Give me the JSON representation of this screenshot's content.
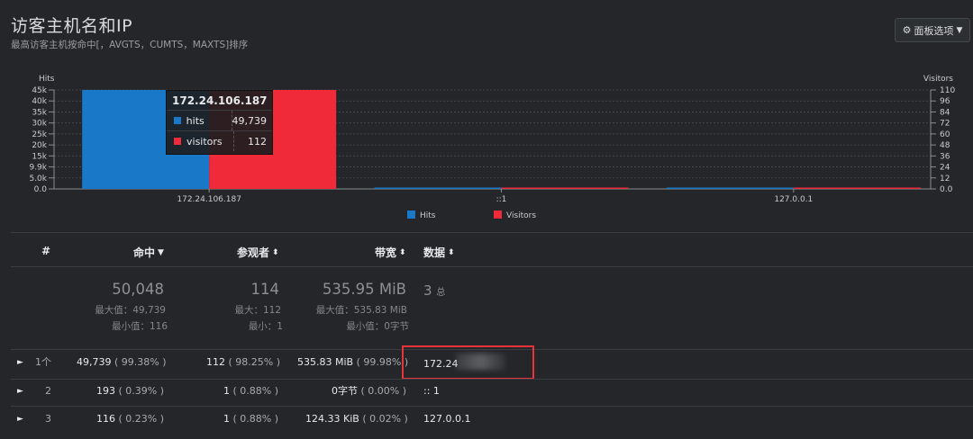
{
  "panel": {
    "title": "访客主机名和IP",
    "subtitle": "最高访客主机按命中[，AVGTS，CUMTS，MAXTS]排序",
    "options_label": "面板选项"
  },
  "chart_data": {
    "type": "bar",
    "categories": [
      "172.24.106.187",
      "::1",
      "127.0.0.1"
    ],
    "series": [
      {
        "name": "Hits",
        "values": [
          49739,
          193,
          116
        ],
        "color": "#1a78c9",
        "axis": "left"
      },
      {
        "name": "Visitors",
        "values": [
          112,
          1,
          1
        ],
        "color": "#f12a3a",
        "axis": "right"
      }
    ],
    "ylabel": "Hits",
    "y2label": "Visitors",
    "yticks_left": [
      "45k",
      "40k",
      "35k",
      "30k",
      "25k",
      "20k",
      "15k",
      "9.9k",
      "5.0k",
      "0.0"
    ],
    "ylim_left": [
      0,
      49739
    ],
    "yticks_right": [
      "110",
      "96",
      "84",
      "72",
      "60",
      "48",
      "36",
      "24",
      "12",
      "0.0"
    ],
    "ylim_right": [
      0,
      112
    ],
    "legend": [
      "Hits",
      "Visitors"
    ],
    "legend_position": "bottom",
    "grid": true
  },
  "tooltip": {
    "title": "172.24.106.187",
    "rows": [
      {
        "name": "hits",
        "value": "49,739",
        "color": "#1a78c9"
      },
      {
        "name": "visitors",
        "value": "112",
        "color": "#f12a3a"
      }
    ]
  },
  "table": {
    "headers": {
      "index": "#",
      "hits": "命中",
      "visitors": "参观者",
      "bandwidth": "带宽",
      "data": "数据"
    },
    "summary": {
      "hits_total": "50,048",
      "hits_max": "最大值：49,739",
      "hits_min": "最小值：116",
      "visitors_total": "114",
      "visitors_max": "最大：112",
      "visitors_min": "最小：1",
      "bw_total": "535.95 MiB",
      "bw_max": "最大值：535.83 MiB",
      "bw_min": "最小值：0字节",
      "data_total": "3",
      "data_total_suffix": "总"
    },
    "rows": [
      {
        "idx": "1个",
        "hits": "49,739",
        "hits_pct": "( 99.38% )",
        "visitors": "112",
        "visitors_pct": "( 98.25% )",
        "bw": "535.83 MiB",
        "bw_pct": "( 99.98% )",
        "data": "172.24"
      },
      {
        "idx": "2",
        "hits": "193",
        "hits_pct": "( 0.39% )",
        "visitors": "1",
        "visitors_pct": "( 0.88% )",
        "bw": "0字节",
        "bw_pct": "( 0.00% )",
        "data": ":: 1"
      },
      {
        "idx": "3",
        "hits": "116",
        "hits_pct": "( 0.23% )",
        "visitors": "1",
        "visitors_pct": "( 0.88% )",
        "bw": "124.33 KiB",
        "bw_pct": "( 0.02% )",
        "data": "127.0.0.1"
      }
    ]
  },
  "colors": {
    "background": "#242629",
    "hits": "#1a78c9",
    "visitors": "#f12a3a",
    "highlight": "#e8333b"
  }
}
